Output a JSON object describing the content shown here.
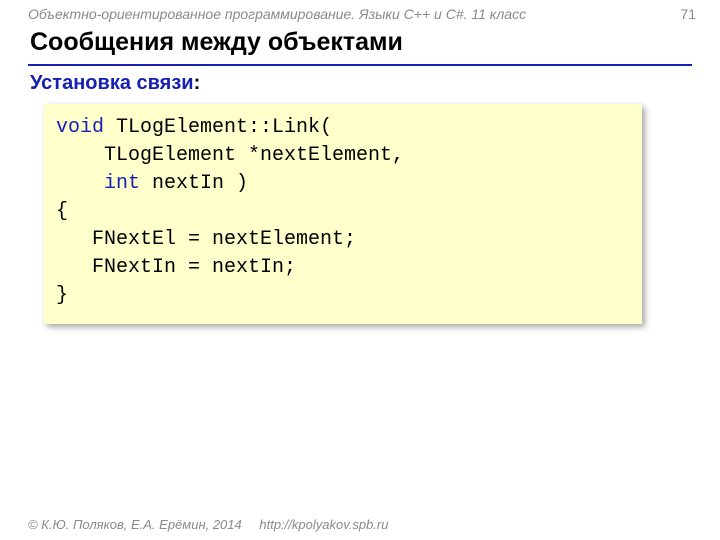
{
  "breadcrumb": "Объектно-ориентированное программирование. Языки C++ и C#. 11 класс",
  "page_number": "71",
  "title": "Сообщения между объектами",
  "subtitle_text": "Установка связи",
  "subtitle_colon": ":",
  "code": {
    "kw_void": "void",
    "sig_rest": " TLogElement::Link(",
    "line2": "    TLogElement *nextElement,",
    "kw_int": "int",
    "line3_prefix": "    ",
    "line3_rest": " nextIn )",
    "line4": "{",
    "line5": "   FNextEl = nextElement;",
    "line6": "   FNextIn = nextIn;",
    "line7": "}"
  },
  "footer": {
    "copyright": "© К.Ю. Поляков, Е.А. Ерёмин, 2014",
    "url": "http://kpolyakov.spb.ru"
  }
}
